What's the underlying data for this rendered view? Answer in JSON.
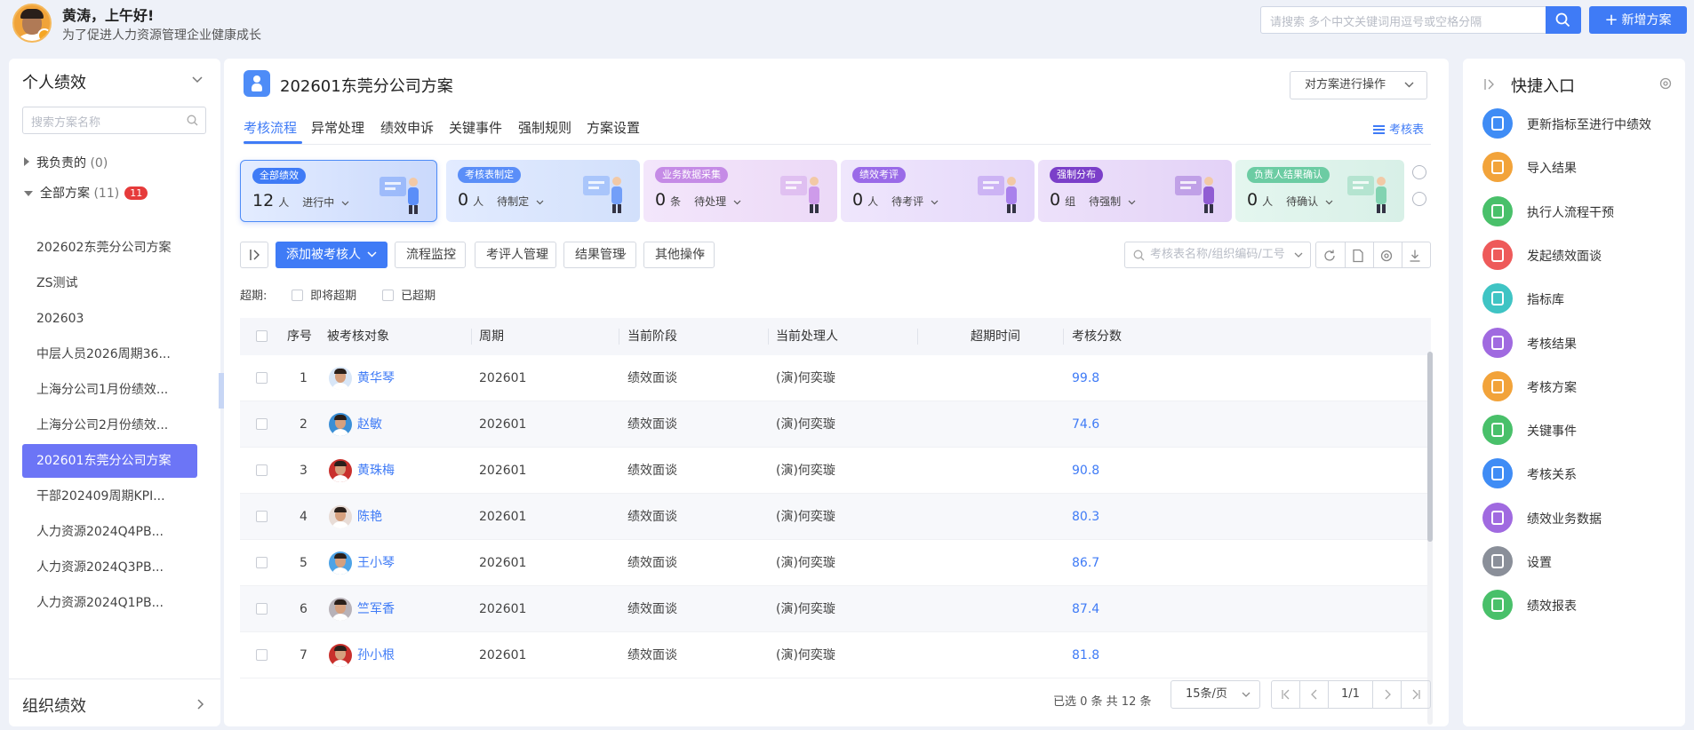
{
  "header": {
    "greeting": "黄涛，上午好!",
    "subtitle": "为了促进人力资源管理企业健康成长",
    "search_placeholder": "请搜索 多个中文关键词用逗号或空格分隔",
    "new_button": "新增方案"
  },
  "sidebar": {
    "title": "个人绩效",
    "search_placeholder": "搜索方案名称",
    "my_group": "我负责的",
    "my_count": "(0)",
    "all_group": "全部方案",
    "all_count": "(11)",
    "all_badge": "11",
    "items": [
      "202602东莞分公司方案",
      "ZS测试",
      "202603",
      "中层人员2026周期36...",
      "上海分公司1月份绩效...",
      "上海分公司2月份绩效...",
      "202601东莞分公司方案",
      "干部202409周期KPI...",
      "人力资源2024Q4PB...",
      "人力资源2024Q3PB...",
      "人力资源2024Q1PB..."
    ],
    "active_index": 6,
    "footer": "组织绩效"
  },
  "main": {
    "title": "202601东莞分公司方案",
    "operate_button": "对方案进行操作",
    "tabs": [
      "考核流程",
      "异常处理",
      "绩效申诉",
      "关键事件",
      "强制规则",
      "方案设置"
    ],
    "active_tab": 0,
    "sheet_link": "考核表"
  },
  "cards": [
    {
      "tag": "全部绩效",
      "num": "12",
      "unit": "人",
      "state": "进行中",
      "color": "#3f7bf6"
    },
    {
      "tag": "考核表制定",
      "num": "0",
      "unit": "人",
      "state": "待制定",
      "color": "#5a8ef8"
    },
    {
      "tag": "业务数据采集",
      "num": "0",
      "unit": "条",
      "state": "待处理",
      "color": "#c58be6"
    },
    {
      "tag": "绩效考评",
      "num": "0",
      "unit": "人",
      "state": "待考评",
      "color": "#9a6ae8"
    },
    {
      "tag": "强制分布",
      "num": "0",
      "unit": "组",
      "state": "待强制",
      "color": "#7b3fc9"
    },
    {
      "tag": "负责人结果确认",
      "num": "0",
      "unit": "人",
      "state": "待确认",
      "color": "#6ccca3"
    }
  ],
  "toolbar": {
    "add_button": "添加被考核人",
    "dropdowns": [
      "流程监控",
      "考评人管理",
      "结果管理",
      "其他操作"
    ],
    "search_placeholder": "考核表名称/组织编码/工号"
  },
  "filters": {
    "label": "超期:",
    "options": [
      "即将超期",
      "已超期"
    ]
  },
  "table": {
    "headers": [
      "序号",
      "被考核对象",
      "周期",
      "当前阶段",
      "当前处理人",
      "超期时间",
      "考核分数"
    ],
    "rows": [
      {
        "no": "1",
        "name": "黄华琴",
        "period": "202601",
        "stage": "绩效面谈",
        "handler": "(演)何奕璇",
        "overdue": "",
        "score": "99.8",
        "bg": "#d8e6f7"
      },
      {
        "no": "2",
        "name": "赵敏",
        "period": "202601",
        "stage": "绩效面谈",
        "handler": "(演)何奕璇",
        "overdue": "",
        "score": "74.6",
        "bg": "#3b8fd6"
      },
      {
        "no": "3",
        "name": "黄珠梅",
        "period": "202601",
        "stage": "绩效面谈",
        "handler": "(演)何奕璇",
        "overdue": "",
        "score": "90.8",
        "bg": "#c9302c"
      },
      {
        "no": "4",
        "name": "陈艳",
        "period": "202601",
        "stage": "绩效面谈",
        "handler": "(演)何奕璇",
        "overdue": "",
        "score": "80.3",
        "bg": "#e8dcd6"
      },
      {
        "no": "5",
        "name": "王小琴",
        "period": "202601",
        "stage": "绩效面谈",
        "handler": "(演)何奕璇",
        "overdue": "",
        "score": "86.7",
        "bg": "#4ea3e6"
      },
      {
        "no": "6",
        "name": "竺军香",
        "period": "202601",
        "stage": "绩效面谈",
        "handler": "(演)何奕璇",
        "overdue": "",
        "score": "87.4",
        "bg": "#b8b2b8"
      },
      {
        "no": "7",
        "name": "孙小根",
        "period": "202601",
        "stage": "绩效面谈",
        "handler": "(演)何奕璇",
        "overdue": "",
        "score": "81.8",
        "bg": "#c9302c"
      }
    ]
  },
  "pagination": {
    "info": "已选 0 条  共 12 条",
    "page_size": "15条/页",
    "page": "1/1"
  },
  "quick": {
    "title": "快捷入口",
    "items": [
      {
        "label": "更新指标至进行中绩效",
        "color": "#3f8cf5"
      },
      {
        "label": "导入结果",
        "color": "#f2a33a"
      },
      {
        "label": "执行人流程干预",
        "color": "#49c06a"
      },
      {
        "label": "发起绩效面谈",
        "color": "#ee5a5a"
      },
      {
        "label": "指标库",
        "color": "#3fc4c4"
      },
      {
        "label": "考核结果",
        "color": "#a06ae0"
      },
      {
        "label": "考核方案",
        "color": "#f2a33a"
      },
      {
        "label": "关键事件",
        "color": "#49c06a"
      },
      {
        "label": "考核关系",
        "color": "#3f8cf5"
      },
      {
        "label": "绩效业务数据",
        "color": "#a06ae0"
      },
      {
        "label": "设置",
        "color": "#8a8f99"
      },
      {
        "label": "绩效报表",
        "color": "#49c06a"
      }
    ]
  }
}
